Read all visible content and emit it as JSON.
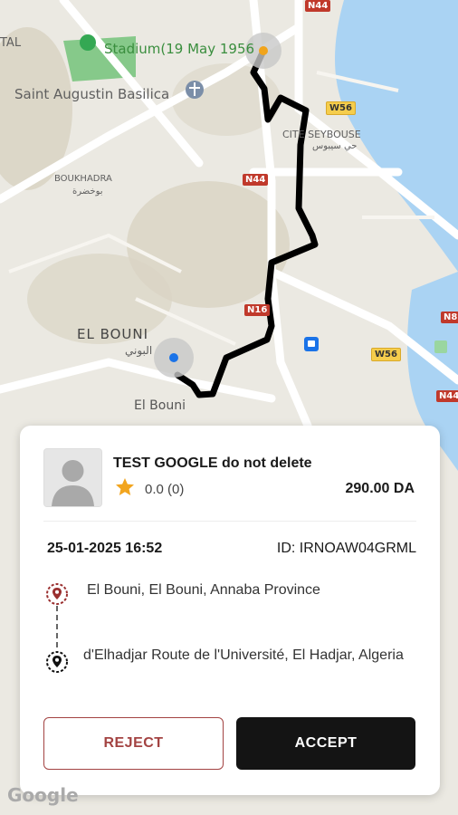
{
  "map": {
    "labels": {
      "stadium": "Stadium(19 May 1956",
      "basilica": "Saint Augustin Basilica",
      "boukhadra": "BOUKHADRA",
      "boukhadra_ar": "بوخضرة",
      "cite_seybouse": "CITE SEYBOUSE",
      "cite_seybouse_ar": "حي سيبوس",
      "el_bouni": "EL BOUNI",
      "el_bouni_ar": "البوني",
      "el_bouni_small": "El Bouni",
      "tal": "TAL"
    },
    "roads": {
      "n44_top": "N44",
      "w56_top": "W56",
      "n44_mid": "N44",
      "n16": "N16",
      "w56_right": "W56",
      "n8_right": "N8",
      "n44_right": "N44"
    },
    "colors": {
      "route": "#000000",
      "water": "#aad3f3",
      "park": "#7cc47f"
    }
  },
  "request": {
    "rider_name": "TEST GOOGLE do not delete",
    "rating": "0.0 (0)",
    "price": "290.00 DA",
    "datetime": "25-01-2025 16:52",
    "ride_id": "ID: IRNOAW04GRML",
    "pickup": "El Bouni, El Bouni, Annaba Province",
    "dropoff": "d'Elhadjar Route de l'Université, El Hadjar, Algeria",
    "reject_label": "REJECT",
    "accept_label": "ACCEPT"
  },
  "footer": {
    "google_logo": "Google"
  }
}
